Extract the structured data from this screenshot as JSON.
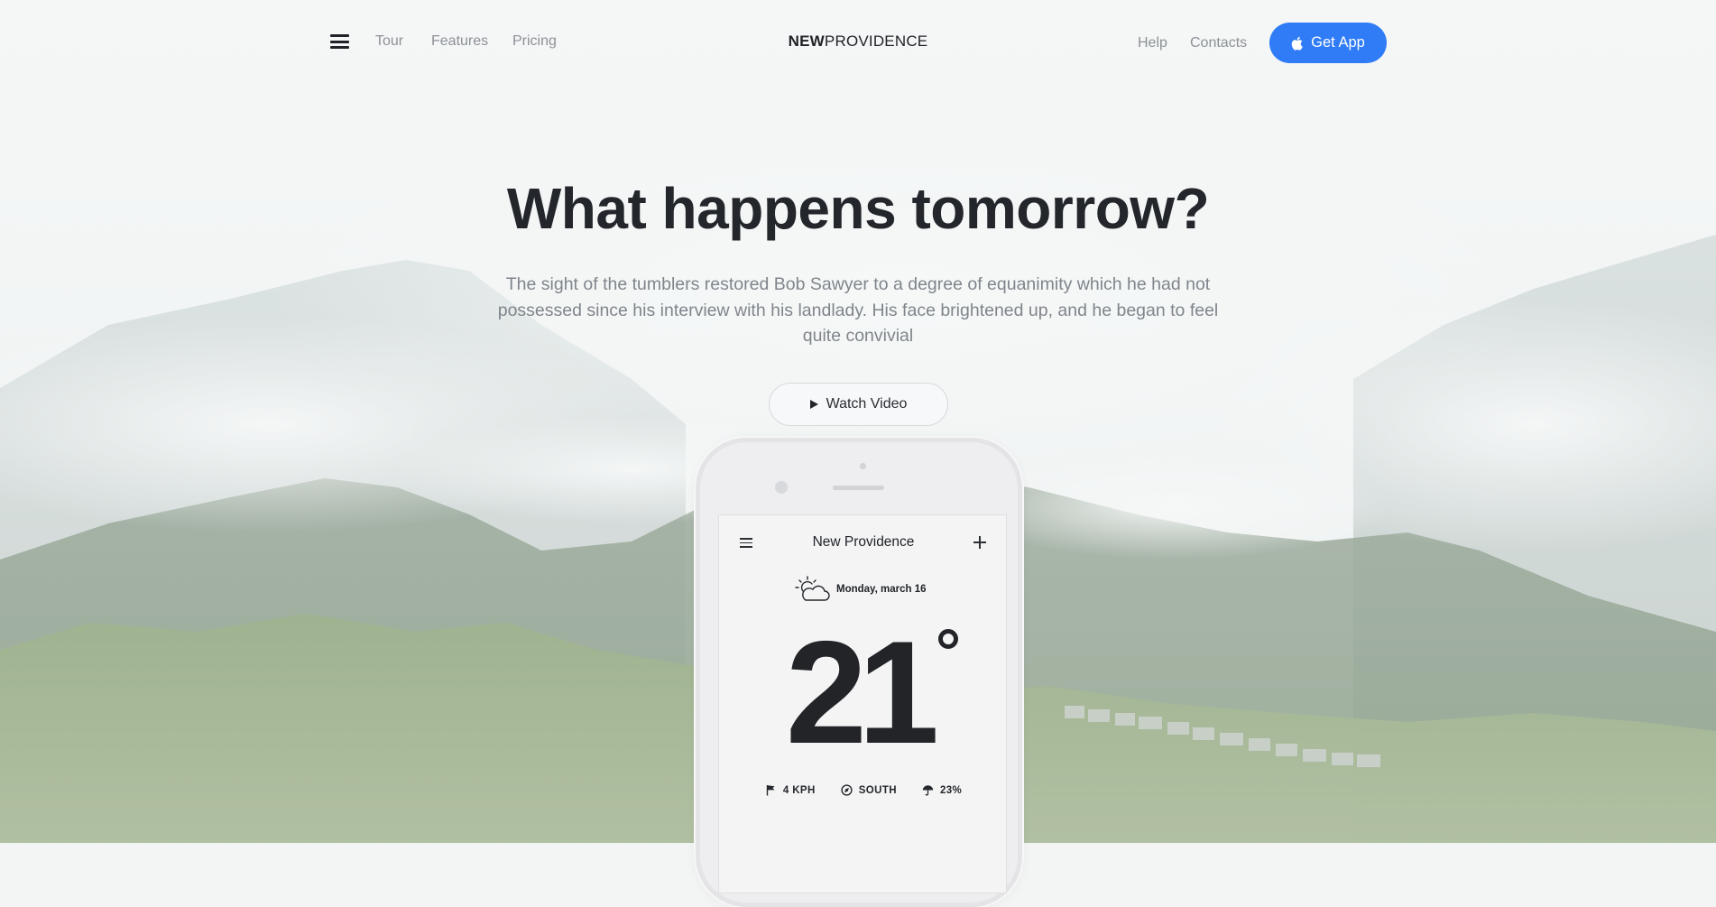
{
  "nav": {
    "links_left": [
      "Tour",
      "Features",
      "Pricing"
    ],
    "brand_bold": "NEW",
    "brand_light": "PROVIDENCE",
    "links_right": [
      "Help",
      "Contacts"
    ],
    "cta_label": "Get App"
  },
  "hero": {
    "headline": "What happens tomorrow?",
    "subtext": "The sight of the tumblers restored Bob Sawyer to a degree of equanimity which he had not possessed since his interview with his landlady. His face brightened up, and he began to feel quite convivial",
    "watch_label": "Watch Video"
  },
  "app": {
    "city": "New Providence",
    "date": "Monday, march 16",
    "temperature": "21",
    "wind": "4 KPH",
    "direction": "SOUTH",
    "precipitation": "23%"
  },
  "colors": {
    "accent": "#2f7cf6",
    "heading": "#23262b",
    "muted_text": "#8c9196"
  },
  "icons": [
    "menu-icon",
    "apple-icon",
    "play-icon",
    "partly-cloudy-icon",
    "plus-icon",
    "flag-icon",
    "compass-icon",
    "umbrella-icon",
    "degree-icon"
  ]
}
